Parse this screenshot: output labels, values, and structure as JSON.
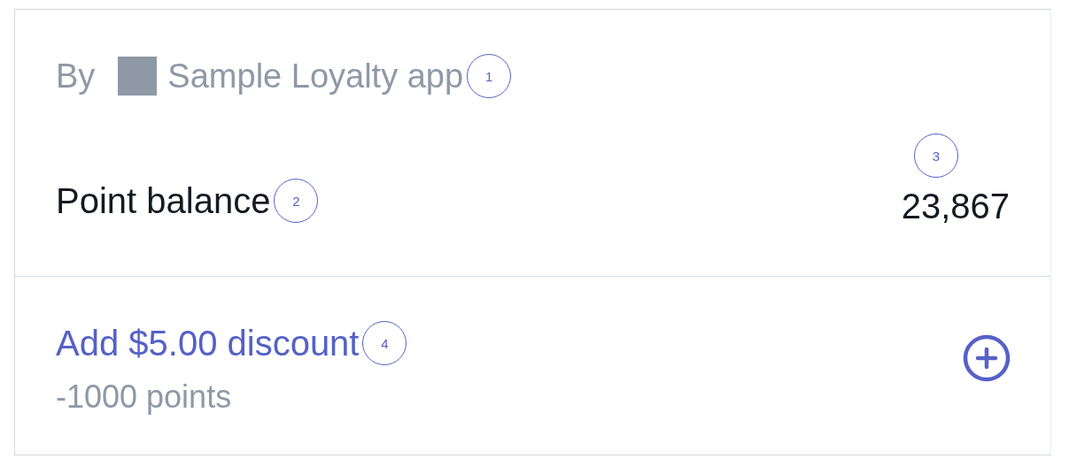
{
  "header": {
    "by_label": "By",
    "app_name": "Sample Loyalty app",
    "marker": "1"
  },
  "balance": {
    "label": "Point balance",
    "label_marker": "2",
    "value": "23,867",
    "value_marker": "3"
  },
  "rewards": [
    {
      "title": "Add $5.00 discount",
      "marker": "4",
      "cost": "-1000 points"
    }
  ]
}
